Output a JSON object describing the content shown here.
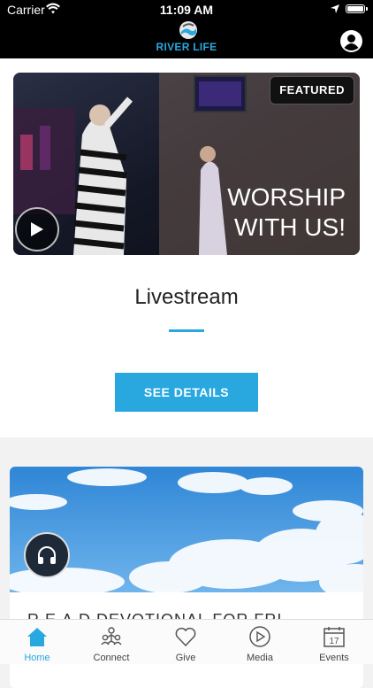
{
  "status_bar": {
    "carrier": "Carrier",
    "time": "11:09 AM"
  },
  "header": {
    "logo_text": "RIVER LIFE"
  },
  "featured": {
    "badge": "FEATURED",
    "image_text_line1": "WORSHIP",
    "image_text_line2": "WITH US!",
    "title": "Livestream",
    "button_label": "SEE DETAILS"
  },
  "second_card": {
    "title_partial": "R.E.A.D DEVOTIONAL FOR FRI"
  },
  "tabs": [
    {
      "label": "Home",
      "icon": "home-icon",
      "active": true
    },
    {
      "label": "Connect",
      "icon": "people-icon",
      "active": false
    },
    {
      "label": "Give",
      "icon": "heart-icon",
      "active": false
    },
    {
      "label": "Media",
      "icon": "play-circle-icon",
      "active": false
    },
    {
      "label": "Events",
      "icon": "calendar-icon",
      "active": false
    }
  ],
  "calendar_day": "17",
  "colors": {
    "accent": "#29a8e0",
    "header_bg": "#000000"
  }
}
